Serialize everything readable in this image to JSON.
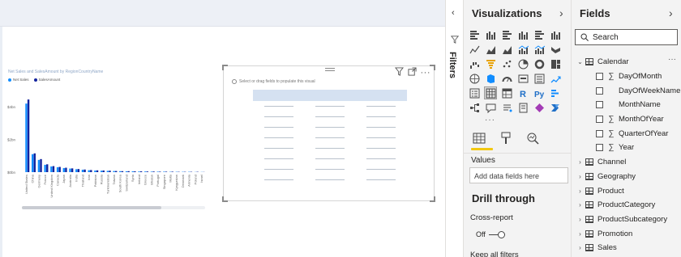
{
  "canvas": {
    "visual1": {
      "title": "Net Sales and SalesAmount by RegionCountryName",
      "legend": [
        {
          "name": "Net Sales",
          "color": "#118dff"
        },
        {
          "name": "SalesAmount",
          "color": "#12239e"
        }
      ]
    },
    "visual2": {
      "hint": "Select or drag fields to populate this visual",
      "tools": {
        "filter_icon": "filter-icon",
        "focus_icon": "focus-mode-icon",
        "more_icon": "more-options-icon"
      }
    }
  },
  "chart_data": {
    "type": "bar",
    "title": "Net Sales and SalesAmount by RegionCountryName",
    "yticks": [
      "$4bn",
      "$2bn",
      "$0bn"
    ],
    "ylim": [
      0,
      5
    ],
    "categories": [
      "United States",
      "China",
      "Germany",
      "France",
      "United Kingdom",
      "Canada",
      "Japan",
      "Australia",
      "India",
      "Thailand",
      "Iran",
      "Pakistan",
      "Russia",
      "Turkmenistan",
      "Taiwan",
      "South Korea",
      "Switzerland",
      "Syria",
      "Ireland",
      "Greece",
      "Bhutan",
      "Portugal",
      "Singapore",
      "Malta",
      "Kyrgyzstan",
      "Denmark",
      "Armenia",
      "Poland",
      "Israel"
    ],
    "series": [
      {
        "name": "Net Sales",
        "color": "#118dff",
        "values": [
          4.2,
          1.1,
          0.75,
          0.45,
          0.35,
          0.3,
          0.25,
          0.22,
          0.18,
          0.15,
          0.12,
          0.1,
          0.09,
          0.08,
          0.07,
          0.06,
          0.05,
          0.05,
          0.04,
          0.04,
          0.03,
          0.03,
          0.03,
          0.02,
          0.02,
          0.02,
          0.02,
          0.01,
          0.01
        ]
      },
      {
        "name": "SalesAmount",
        "color": "#12239e",
        "values": [
          4.45,
          1.15,
          0.8,
          0.48,
          0.37,
          0.32,
          0.27,
          0.23,
          0.19,
          0.16,
          0.13,
          0.11,
          0.1,
          0.09,
          0.07,
          0.06,
          0.06,
          0.05,
          0.05,
          0.04,
          0.04,
          0.03,
          0.03,
          0.03,
          0.02,
          0.02,
          0.02,
          0.02,
          0.01
        ]
      }
    ],
    "grid": false,
    "legend_position": "top-left"
  },
  "filters": {
    "label": "Filters"
  },
  "visualizations": {
    "title": "Visualizations",
    "icons": [
      "stacked-bar-chart-icon",
      "stacked-column-chart-icon",
      "clustered-bar-chart-icon",
      "clustered-column-chart-icon",
      "100-stacked-bar-chart-icon",
      "100-stacked-column-chart-icon",
      "line-chart-icon",
      "area-chart-icon",
      "stacked-area-chart-icon",
      "line-clustered-column-chart-icon",
      "line-stacked-column-chart-icon",
      "ribbon-chart-icon",
      "waterfall-chart-icon",
      "funnel-chart-icon",
      "scatter-chart-icon",
      "pie-chart-icon",
      "donut-chart-icon",
      "treemap-icon",
      "map-icon",
      "filled-map-icon",
      "gauge-icon",
      "card-icon",
      "multi-row-card-icon",
      "kpi-icon",
      "slicer-icon",
      "table-icon",
      "matrix-icon",
      "r-script-visual-icon",
      "python-visual-icon",
      "key-influencers-icon",
      "decomposition-tree-icon",
      "qa-icon",
      "smart-narrative-icon",
      "paginated-report-icon",
      "power-apps-icon",
      "power-automate-icon"
    ],
    "more_label": "···",
    "selected_icon": "table-icon",
    "tabs": [
      "fields-tab-icon",
      "format-tab-icon",
      "analytics-tab-icon"
    ],
    "values_label": "Values",
    "values_placeholder": "Add data fields here",
    "drill_title": "Drill through",
    "cross_report_label": "Cross-report",
    "cross_report_state": "Off",
    "keep_all_filters_label": "Keep all filters"
  },
  "fields": {
    "title": "Fields",
    "search_placeholder": "Search",
    "tables": [
      {
        "name": "Calendar",
        "expanded": true,
        "columns": [
          {
            "name": "DayOfMonth",
            "sigma": true
          },
          {
            "name": "DayOfWeekName",
            "sigma": false
          },
          {
            "name": "MonthName",
            "sigma": false
          },
          {
            "name": "MonthOfYear",
            "sigma": true
          },
          {
            "name": "QuarterOfYear",
            "sigma": true
          },
          {
            "name": "Year",
            "sigma": true
          }
        ]
      },
      {
        "name": "Channel",
        "expanded": false
      },
      {
        "name": "Geography",
        "expanded": false
      },
      {
        "name": "Product",
        "expanded": false
      },
      {
        "name": "ProductCategory",
        "expanded": false
      },
      {
        "name": "ProductSubcategory",
        "expanded": false
      },
      {
        "name": "Promotion",
        "expanded": false
      },
      {
        "name": "Sales",
        "expanded": false
      }
    ],
    "more_label": "···"
  }
}
